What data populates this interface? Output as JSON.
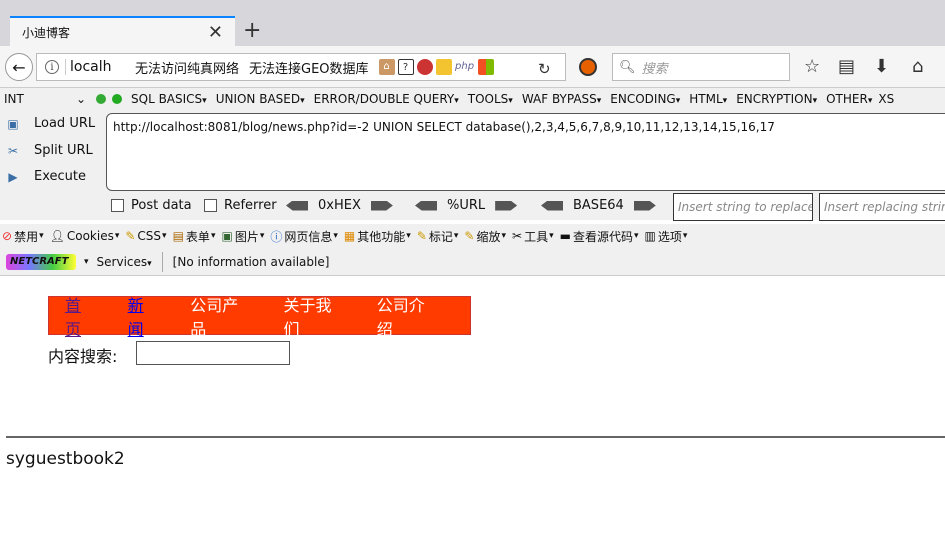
{
  "browser": {
    "tab_title": "小迪博客",
    "url_short": "localh",
    "url_messages": [
      "无法访问纯真网络",
      "无法连接GEO数据库"
    ],
    "search_placeholder": "搜索"
  },
  "hackbar": {
    "type_select": "INT",
    "menus": [
      "SQL BASICS",
      "UNION BASED",
      "ERROR/DOUBLE QUERY",
      "TOOLS",
      "WAF BYPASS",
      "ENCODING",
      "HTML",
      "ENCRYPTION",
      "OTHER",
      "XS"
    ],
    "actions": [
      "Load URL",
      "Split URL",
      "Execute"
    ],
    "url_value": "http://localhost:8081/blog/news.php?id=-2  UNION SELECT database(),2,3,4,5,6,7,8,9,10,11,12,13,14,15,16,17",
    "post_data_label": "Post data",
    "referrer_label": "Referrer",
    "encoders": [
      "0xHEX",
      "%URL",
      "BASE64"
    ],
    "replace_placeholder": "Insert string to replace",
    "replacing_placeholder": "Insert replacing string"
  },
  "webdev": {
    "items": [
      "禁用",
      "Cookies",
      "CSS",
      "表单",
      "图片",
      "网页信息",
      "其他功能",
      "标记",
      "缩放",
      "工具",
      "查看源代码",
      "选项"
    ]
  },
  "netcraft": {
    "logo": "NETCRAFT",
    "services": "Services",
    "info": "[No information available]"
  },
  "page": {
    "nav": [
      "首页",
      "新闻",
      "公司产品",
      "关于我们",
      "公司介绍"
    ],
    "search_label": "内容搜索:",
    "result_text": "syguestbook2"
  }
}
